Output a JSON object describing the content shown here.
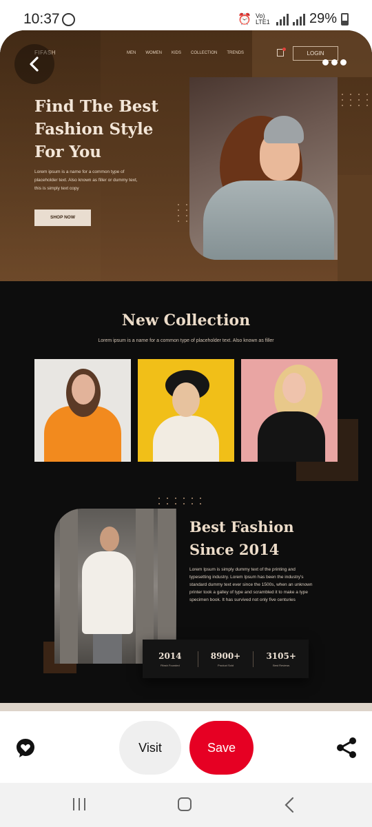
{
  "status_bar": {
    "time": "10:37",
    "network_label": "Vo) LTE1",
    "battery": "29%"
  },
  "pin": {
    "site": {
      "logo": "FIFASH",
      "nav": [
        "MEN",
        "WOMEN",
        "KIDS",
        "COLLECTION",
        "TRENDS"
      ],
      "login": "LOGIN"
    },
    "hero": {
      "title": "Find The Best Fashion Style For You",
      "text": "Lorem ipsum is a name for a common type of placeholder text. Also known as filler or dummy text, this is simply text copy",
      "button": "SHOP NOW"
    },
    "collection": {
      "title": "New Collection",
      "subtitle": "Lorem ipsum is a name for a common type of placeholder text. Also known as filler"
    },
    "about": {
      "title": "Best Fashion Since 2014",
      "text": "Lorem Ipsum is simply dummy text of the printing and typesetting industry. Lorem Ipsum has been the industry's standard dummy text ever since the 1500s, when an unknown printer took a galley of type and scrambled it to make a type specimen book. It has survived not only five centuries",
      "stats": [
        {
          "value": "2014",
          "label": "Fifash Founded"
        },
        {
          "value": "8900+",
          "label": "Product Sold"
        },
        {
          "value": "3105+",
          "label": "Best Reviews"
        }
      ]
    }
  },
  "actions": {
    "visit": "Visit",
    "save": "Save"
  },
  "colors": {
    "save": "#e60023",
    "hero_brown": "#5a3b20",
    "dark_bg": "#0d0d0d"
  },
  "icons": [
    "back-arrow-icon",
    "more-dots-icon",
    "heart-chat-icon",
    "share-icon",
    "cart-icon"
  ]
}
